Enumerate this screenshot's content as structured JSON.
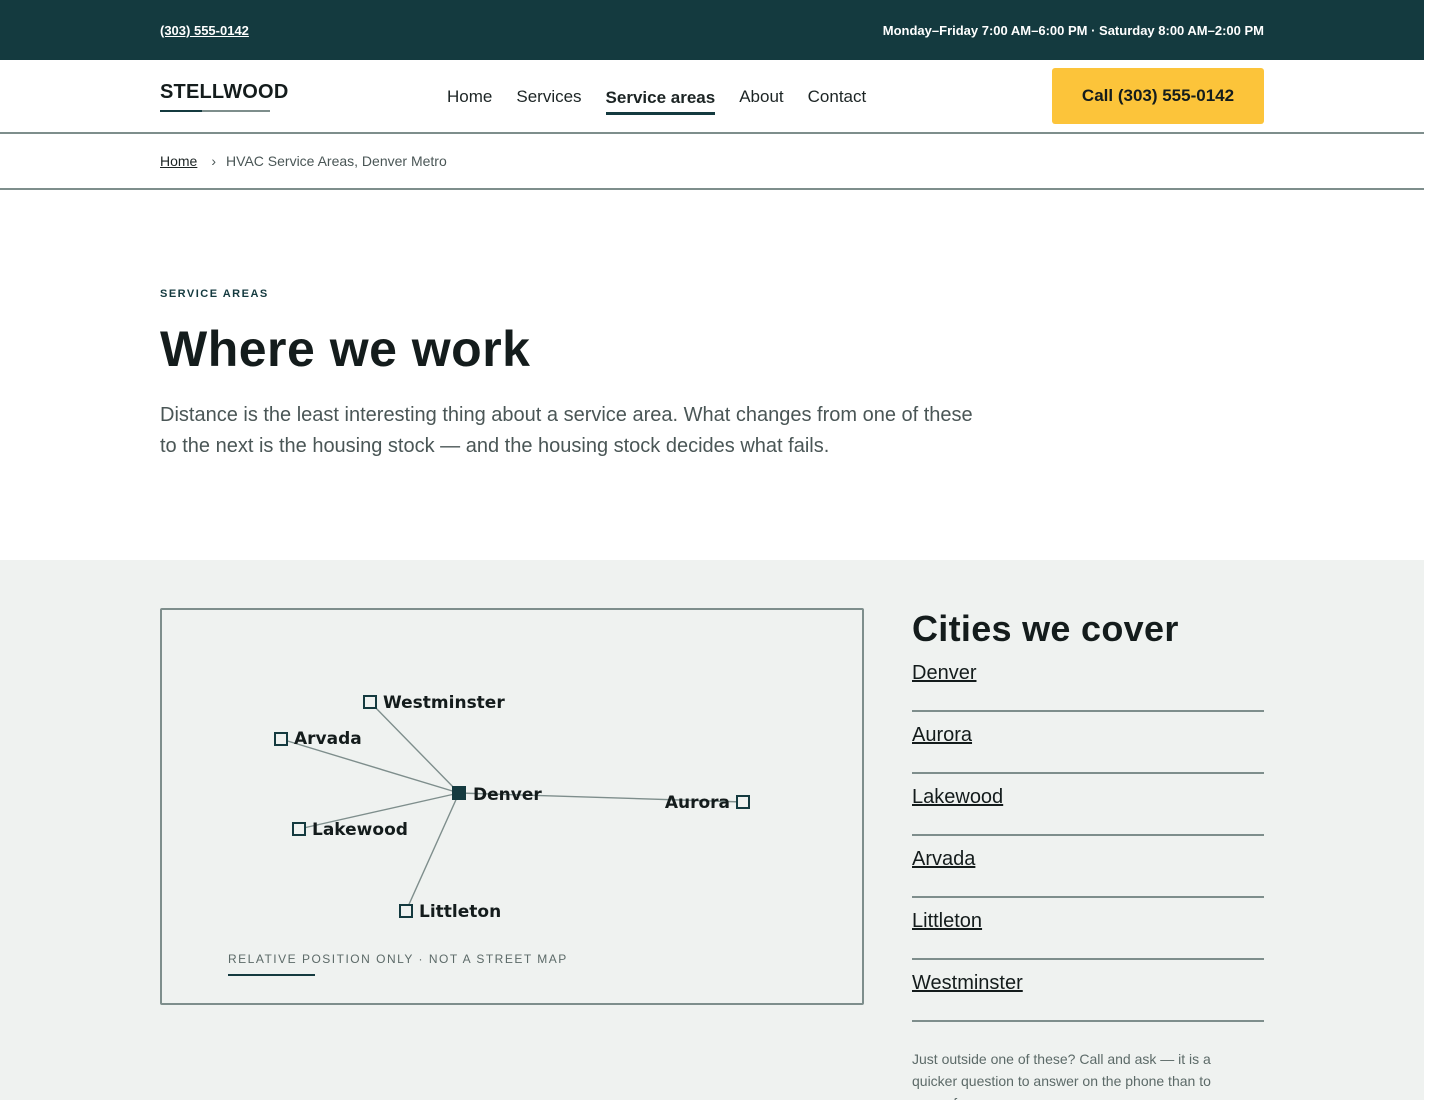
{
  "topbar": {
    "phone": "(303) 555-0142",
    "hours": "Monday–Friday 7:00 AM–6:00 PM · Saturday 8:00 AM–2:00 PM"
  },
  "header": {
    "logo": "STELLWOOD",
    "nav": [
      {
        "label": "Home"
      },
      {
        "label": "Services"
      },
      {
        "label": "Service areas"
      },
      {
        "label": "About"
      },
      {
        "label": "Contact"
      }
    ],
    "active_nav": "Service areas",
    "cta_label": "Call (303) 555-0142"
  },
  "breadcrumb": {
    "home": "Home",
    "separator": "›",
    "current": "HVAC Service Areas, Denver Metro"
  },
  "hero": {
    "eyebrow": "SERVICE AREAS",
    "title": "Where we work",
    "lede": "Distance is the least interesting thing about a service area. What changes from one of these to the next is the housing stock — and the housing stock decides what fails."
  },
  "map": {
    "hub": "Denver",
    "cities": [
      "Westminster",
      "Arvada",
      "Lakewood",
      "Littleton",
      "Aurora"
    ],
    "note": "RELATIVE POSITION ONLY · NOT A STREET MAP"
  },
  "cities": {
    "title": "Cities we cover",
    "items": [
      "Denver",
      "Aurora",
      "Lakewood",
      "Arvada",
      "Littleton",
      "Westminster"
    ],
    "note": "Just outside one of these? Call and ask — it is a quicker question to answer on the phone than to guess from a map."
  },
  "colors": {
    "brand_dark": "#143a3f",
    "accent": "#fcc43a",
    "section_bg": "#eff2f0",
    "rule": "#7e8e8c"
  }
}
